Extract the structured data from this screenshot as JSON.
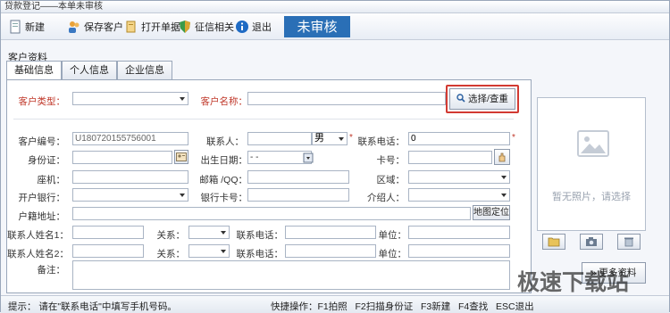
{
  "window": {
    "title": "贷款登记——本单未审核"
  },
  "toolbar": {
    "new_label": "新建",
    "save_label": "保存客户",
    "open_label": "打开单据",
    "credit_label": "征信相关",
    "exit_label": "退出",
    "status_label": "未审核"
  },
  "section": {
    "label": "客户资料"
  },
  "tabs": [
    "基础信息",
    "个人信息",
    "企业信息"
  ],
  "form": {
    "customer_type": {
      "label": "客户类型：",
      "value": ""
    },
    "customer_name": {
      "label": "客户名称：",
      "value": ""
    },
    "select_button": "选择/查重",
    "customer_no": {
      "label": "客户编号：",
      "value": "U180720155756001"
    },
    "contact": {
      "label": "联系人：",
      "value": ""
    },
    "gender": {
      "value": "男"
    },
    "contact_phone": {
      "label": "联系电话：",
      "value": "0"
    },
    "id_card": {
      "label": "身份证：",
      "value": ""
    },
    "birth_date": {
      "label": "出生日期：",
      "value": "-  -"
    },
    "card_no": {
      "label": "卡号：",
      "value": ""
    },
    "landline": {
      "label": "座机：",
      "value": ""
    },
    "email_qq": {
      "label": "邮箱 /QQ：",
      "value": ""
    },
    "region": {
      "label": "区域：",
      "value": ""
    },
    "bank": {
      "label": "开户银行：",
      "value": ""
    },
    "bank_card": {
      "label": "银行卡号：",
      "value": ""
    },
    "referrer": {
      "label": "介绍人：",
      "value": ""
    },
    "address": {
      "label": "户籍地址：",
      "value": ""
    },
    "map_button": "地图定位",
    "contact_rows": [
      {
        "name_label": "联系人姓名1：",
        "rel_label": "关系：",
        "phone_label": "联系电话：",
        "unit_label": "单位："
      },
      {
        "name_label": "联系人姓名2：",
        "rel_label": "关系：",
        "phone_label": "联系电话：",
        "unit_label": "单位："
      }
    ],
    "remark": {
      "label": "备注：",
      "value": ""
    }
  },
  "photo": {
    "placeholder": "暂无照片，请选择"
  },
  "more_button": "更多资料",
  "statusbar": {
    "tip": "提示： 请在\"联系电话\"中填写手机号码。",
    "shortcuts": "快捷操作：F1拍照   F2扫描身份证   F3新建   F4查找   ESC退出"
  },
  "watermark": "极速下载站",
  "colors": {
    "accent": "#2a6fb6",
    "required": "#c0392b",
    "highlight": "#d23a32"
  }
}
